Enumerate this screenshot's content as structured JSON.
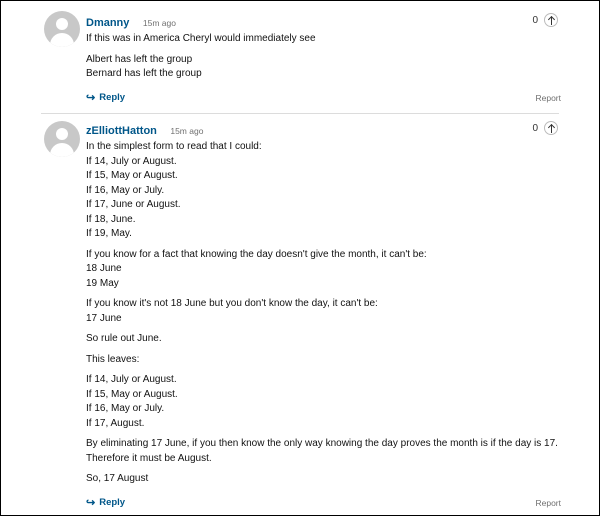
{
  "comments": [
    {
      "username": "Dmanny",
      "time": "15m ago",
      "votes": "0",
      "paragraphs": [
        "If this was in America Cheryl would immediately see",
        "Albert has left the group\nBernard has left the group"
      ],
      "reply_label": "Reply",
      "report_label": "Report"
    },
    {
      "username": "zElliottHatton",
      "time": "15m ago",
      "votes": "0",
      "paragraphs": [
        "In the simplest form to read that I could:\nIf 14, July or August.\nIf 15, May or August.\nIf 16, May or July.\nIf 17, June or August.\nIf 18, June.\nIf 19, May.",
        "If you know for a fact that knowing the day doesn't give the month, it can't be:\n18 June\n19 May",
        "If you know it's not 18 June but you don't know the day, it can't be:\n17 June",
        "So rule out June.",
        "This leaves:",
        "If 14, July or August.\nIf 15, May or August.\nIf 16, May or July.\nIf 17, August.",
        "By eliminating 17 June, if you then know the only way knowing the day proves the month is if the day is 17. Therefore it must be August.",
        "So, 17 August"
      ],
      "reply_label": "Reply",
      "report_label": "Report"
    }
  ],
  "icons": {
    "reply": "arrow-reply-icon",
    "upvote": "arrow-up-circle-icon",
    "avatar": "default-avatar-icon"
  },
  "colors": {
    "link": "#005689",
    "muted": "#707070",
    "separator": "#dcdcdc"
  }
}
